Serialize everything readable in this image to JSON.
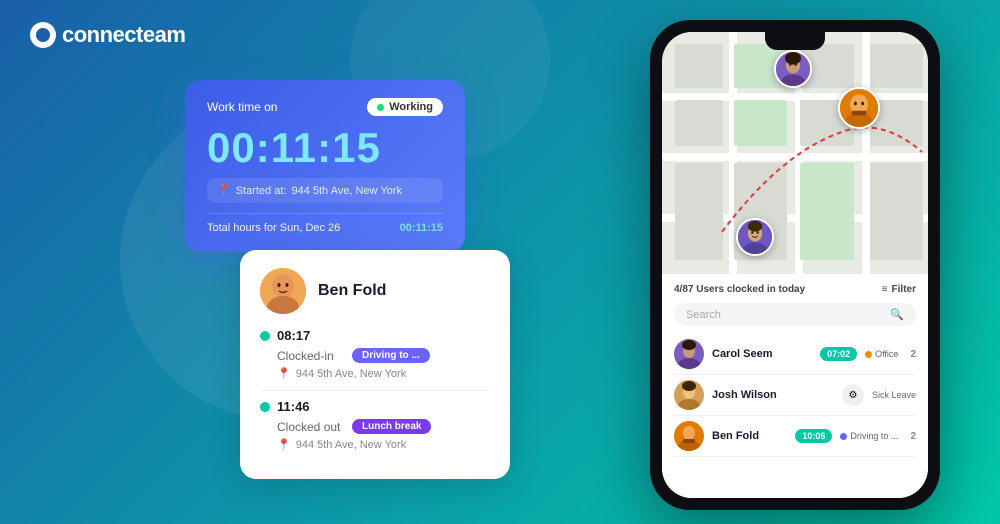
{
  "app": {
    "logo": "connecteam",
    "logo_icon": "c-icon"
  },
  "work_card": {
    "label": "Work time on",
    "status": "Working",
    "timer": "00:11:15",
    "started_label": "Started at:",
    "started_location": "944 5th Ave, New York",
    "total_label": "Total hours for Sun, Dec 26",
    "total_value": "00:11:15"
  },
  "ben_card": {
    "name": "Ben Fold",
    "avatar_alt": "Ben Fold avatar",
    "time1": "08:17",
    "clocked_in_label": "Clocked-in",
    "tag1": "Driving to ...",
    "location1": "944 5th Ave, New York",
    "time2": "11:46",
    "clocked_out_label": "Clocked out",
    "tag2": "Lunch break",
    "location2": "944 5th Ave, New York"
  },
  "phone": {
    "map": {
      "avatars": [
        {
          "id": "person1",
          "alt": "Female user on map"
        },
        {
          "id": "person2",
          "alt": "Male user with beard on map"
        },
        {
          "id": "person3",
          "alt": "Male user on map"
        }
      ]
    },
    "list": {
      "header_count": "4/87 Users clocked in today",
      "filter_label": "Filter",
      "search_placeholder": "Search",
      "users": [
        {
          "name": "Carol Seem",
          "time": "07:02",
          "status": "Office",
          "status_type": "orange",
          "count": "2"
        },
        {
          "name": "Josh Wilson",
          "time": "",
          "status": "Sick Leave",
          "status_type": "gray",
          "count": ""
        },
        {
          "name": "Ben Fold",
          "time": "10:06",
          "status": "Driving to ...",
          "status_type": "purple",
          "count": "2"
        }
      ]
    }
  }
}
